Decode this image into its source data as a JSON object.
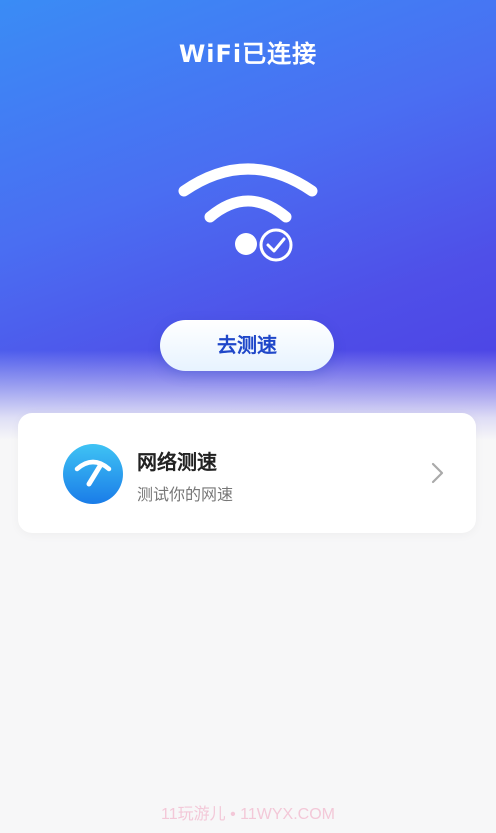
{
  "header": {
    "title": "WiFi已连接"
  },
  "status_graphic": {
    "icon": "wifi-connected-icon",
    "check_icon": "check-circle-icon"
  },
  "actions": {
    "speed_test_label": "去测速"
  },
  "card": {
    "icon": "speedometer-icon",
    "title": "网络测速",
    "subtitle": "测试你的网速",
    "chevron_icon": "chevron-right-icon"
  },
  "watermark": {
    "text": "11玩游儿 • 11WYX.COM"
  },
  "colors": {
    "hero_gradient_start": "#3a8cf5",
    "hero_gradient_end": "#4b3ee4",
    "button_text": "#1f47c9",
    "card_bg": "#ffffff",
    "page_bg": "#f7f7f8"
  }
}
